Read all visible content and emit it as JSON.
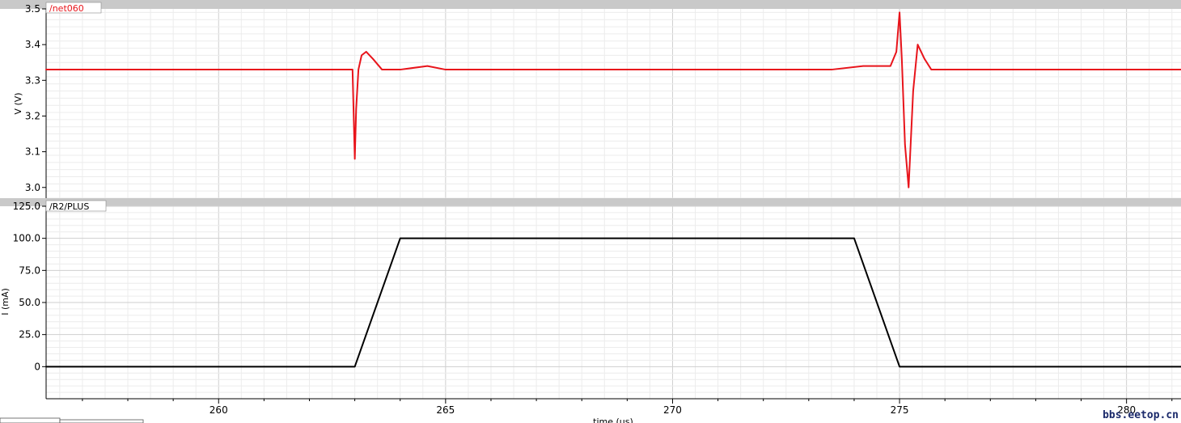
{
  "chart_data": [
    {
      "type": "line",
      "trace_name": "/net060",
      "ylabel": "V (V)",
      "xlim": [
        256.2,
        281.2
      ],
      "ylim": [
        2.97,
        3.5
      ],
      "yticks": [
        3.0,
        3.1,
        3.2,
        3.3,
        3.4,
        3.5
      ],
      "ytick_labels": [
        "3.0",
        "3.1",
        "3.2",
        "3.3",
        "3.4",
        "3.5"
      ],
      "grid": true,
      "series": [
        {
          "color": "#e8141b",
          "x": [
            256.2,
            262.95,
            263.0,
            263.03,
            263.08,
            263.15,
            263.25,
            263.4,
            263.6,
            264.0,
            264.6,
            265.0,
            266.0,
            270.0,
            273.5,
            274.2,
            274.5,
            274.8,
            274.93,
            275.0,
            275.05,
            275.12,
            275.2,
            275.3,
            275.4,
            275.55,
            275.7,
            276.0,
            281.2
          ],
          "y": [
            3.33,
            3.33,
            3.08,
            3.22,
            3.33,
            3.37,
            3.38,
            3.36,
            3.33,
            3.33,
            3.34,
            3.33,
            3.33,
            3.33,
            3.33,
            3.34,
            3.34,
            3.34,
            3.38,
            3.49,
            3.36,
            3.12,
            3.0,
            3.27,
            3.4,
            3.36,
            3.33,
            3.33,
            3.33
          ]
        }
      ]
    },
    {
      "type": "line",
      "trace_name": "/R2/PLUS",
      "ylabel": "I (mA)",
      "xlabel": "time (us)",
      "xlim": [
        256.2,
        281.2
      ],
      "ylim": [
        -25.0,
        125.0
      ],
      "yticks": [
        0,
        25,
        50,
        75,
        100,
        125
      ],
      "ytick_labels": [
        "0",
        "25.0",
        "50.0",
        "75.0",
        "100.0",
        "125.0"
      ],
      "xticks": [
        260,
        265,
        270,
        275,
        280
      ],
      "xtick_labels": [
        "260",
        "265",
        "270",
        "275",
        "280"
      ],
      "grid": true,
      "series": [
        {
          "color": "#000000",
          "x": [
            256.2,
            263.0,
            264.0,
            274.0,
            275.0,
            281.2
          ],
          "y": [
            0,
            0,
            100,
            100,
            0,
            0
          ]
        }
      ]
    }
  ],
  "watermark": "bbs.eetop.cn"
}
